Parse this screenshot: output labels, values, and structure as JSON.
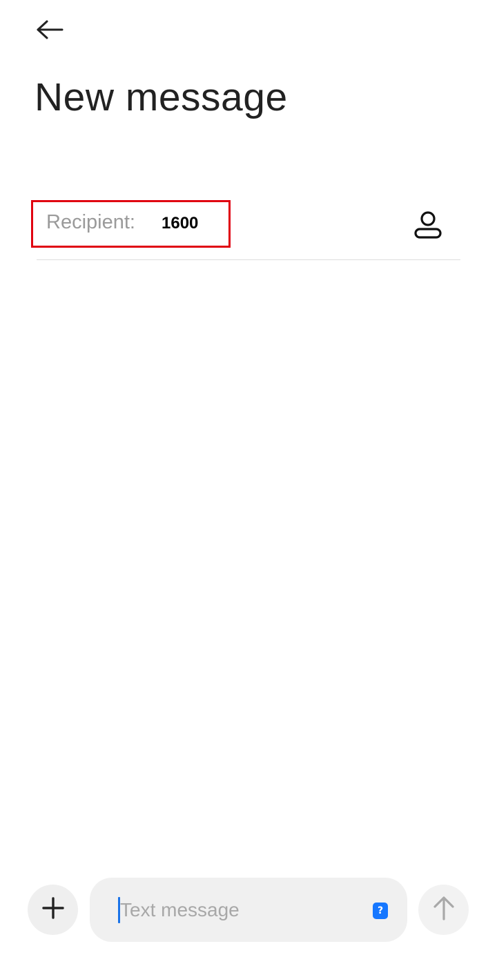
{
  "header": {
    "back_icon": "arrow-left-icon",
    "title": "New message"
  },
  "recipient": {
    "label": "Recipient:",
    "value": "1600",
    "contact_icon": "person-icon",
    "highlight_color": "#e00010"
  },
  "composer": {
    "attach_icon": "plus-icon",
    "placeholder": "Text message",
    "sim_badge": "?",
    "sim_badge_color": "#1677ff",
    "send_icon": "arrow-up-icon",
    "caret_color": "#1a73e8"
  }
}
